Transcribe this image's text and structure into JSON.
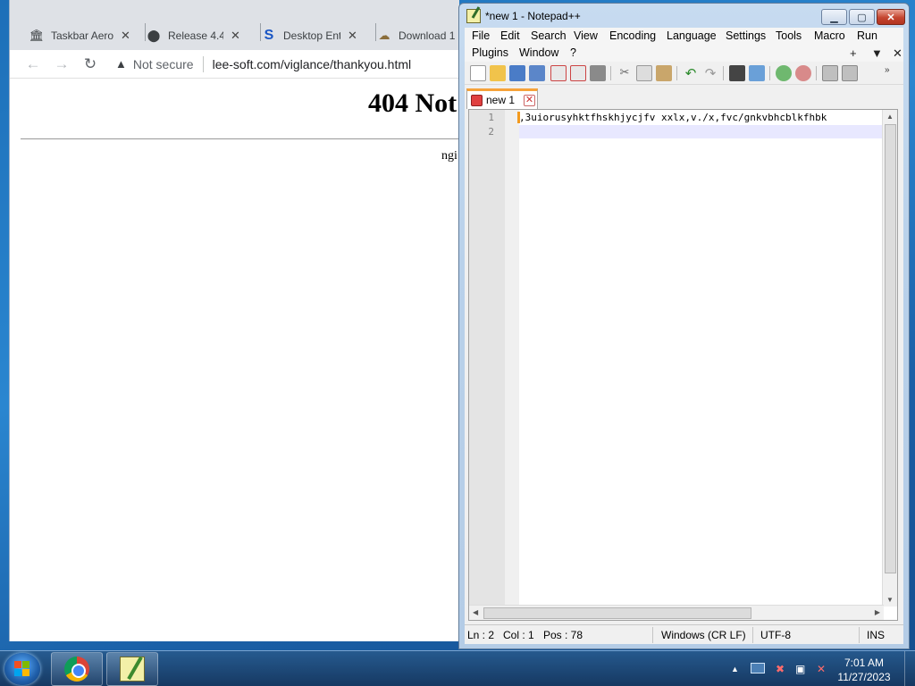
{
  "browser": {
    "tabs": [
      {
        "title": "Taskbar Aero",
        "icon": "bank-icon"
      },
      {
        "title": "Release 4.4.",
        "icon": "github-icon"
      },
      {
        "title": "Desktop Ent",
        "icon": "s-logo-icon"
      },
      {
        "title": "Download 1",
        "icon": "download-icon"
      }
    ],
    "security_label": "Not secure",
    "url": "lee-soft.com/viglance/thankyou.html",
    "page_heading": "404 Not",
    "page_footer": "ngi"
  },
  "notepad": {
    "title": "*new 1 - Notepad++",
    "menu": [
      "File",
      "Edit",
      "Search",
      "View",
      "Encoding",
      "Language",
      "Settings",
      "Tools",
      "Macro",
      "Run",
      "Plugins",
      "Window",
      "?"
    ],
    "menu_controls": [
      "+",
      "▼",
      "✕"
    ],
    "doc_tab": "new 1",
    "lines": [
      {
        "num": "1",
        "text": ",3uiorusyhktfhskhjycjfv xxlx,v./x,fvc/gnkvbhcblkfhbk"
      },
      {
        "num": "2",
        "text": ""
      }
    ],
    "status": {
      "ln": "Ln : 2",
      "col": "Col : 1",
      "pos": "Pos : 78",
      "eol": "Windows (CR LF)",
      "encoding": "UTF-8",
      "mode": "INS"
    }
  },
  "taskbar": {
    "time": "7:01 AM",
    "date": "11/27/2023"
  }
}
